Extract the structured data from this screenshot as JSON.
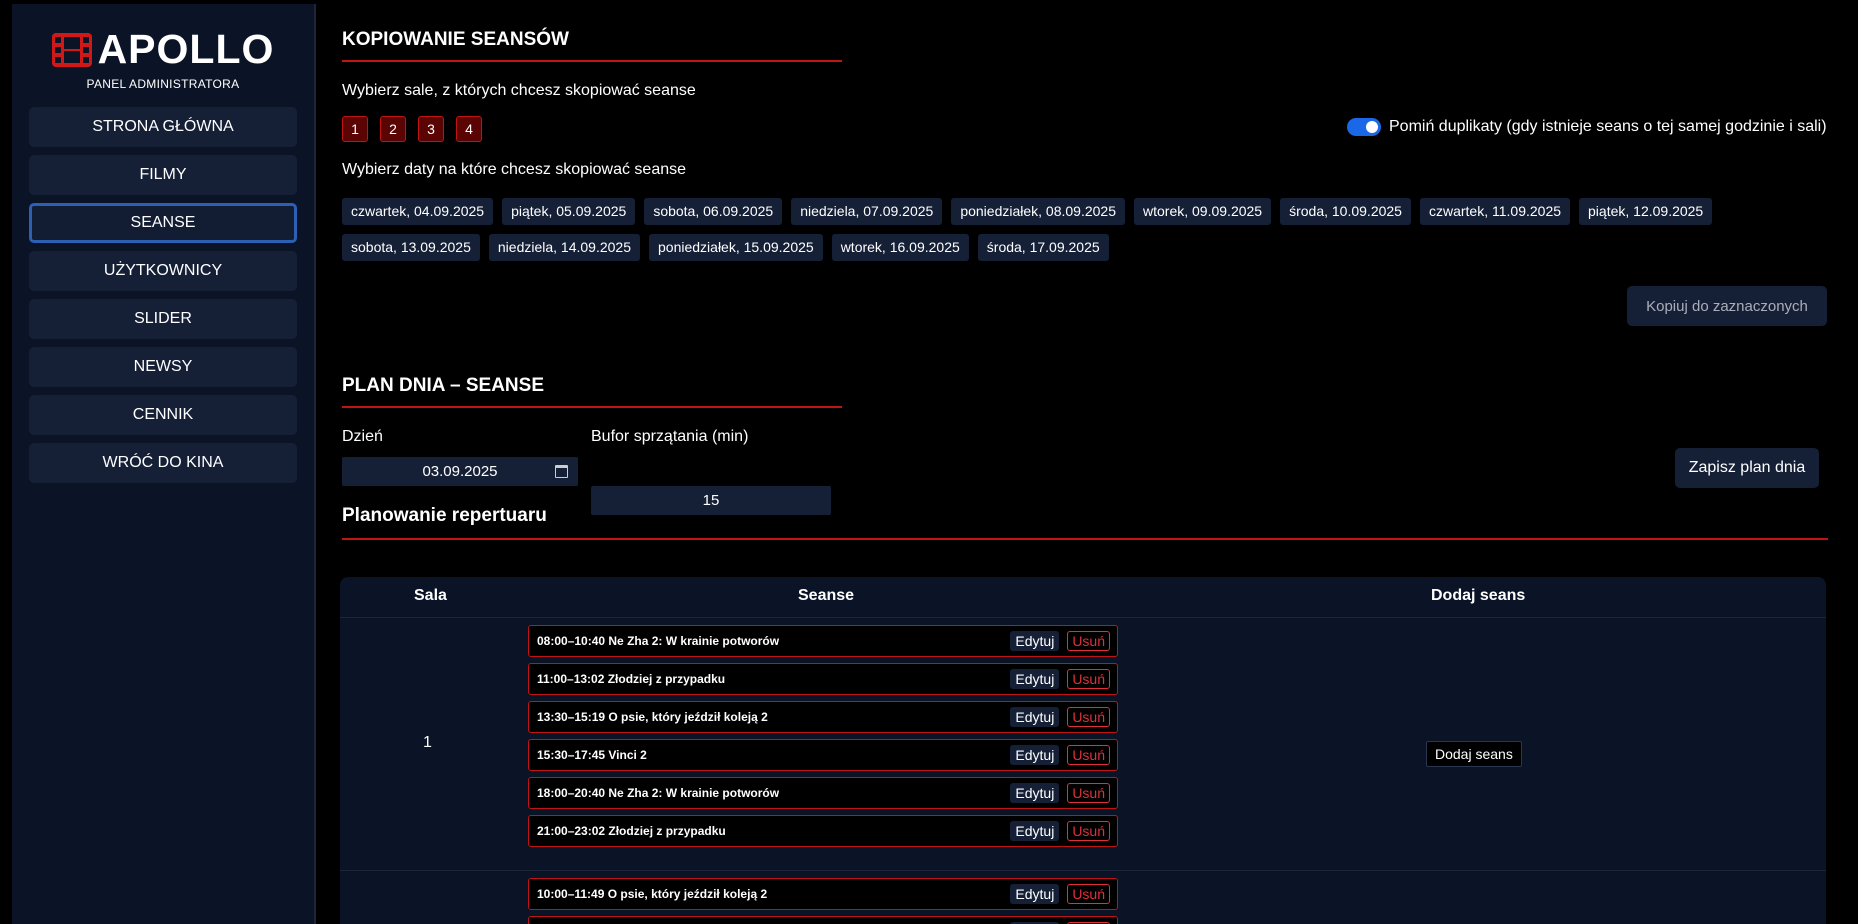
{
  "brand": {
    "name": "APOLLO",
    "subtitle": "PANEL ADMINISTRATORA"
  },
  "nav": [
    {
      "label": "STRONA GŁÓWNA",
      "active": false
    },
    {
      "label": "FILMY",
      "active": false
    },
    {
      "label": "SEANSE",
      "active": true
    },
    {
      "label": "UŻYTKOWNICY",
      "active": false
    },
    {
      "label": "SLIDER",
      "active": false
    },
    {
      "label": "NEWSY",
      "active": false
    },
    {
      "label": "CENNIK",
      "active": false
    },
    {
      "label": "WRÓĆ DO KINA",
      "active": false
    }
  ],
  "copy": {
    "title": "KOPIOWANIE SEANSÓW",
    "halls_label": "Wybierz sale, z których chcesz skopiować seanse",
    "halls": [
      "1",
      "2",
      "3",
      "4"
    ],
    "skip_duplicates_label": "Pomiń duplikaty (gdy istnieje seans o tej samej godzinie i sali)",
    "skip_duplicates": true,
    "dates_label": "Wybierz daty na które chcesz skopiować seanse",
    "dates_row1": [
      "czwartek, 04.09.2025",
      "piątek, 05.09.2025",
      "sobota, 06.09.2025",
      "niedziela, 07.09.2025",
      "poniedziałek, 08.09.2025",
      "wtorek, 09.09.2025",
      "środa, 10.09.2025",
      "czwartek, 11.09.2025",
      "piątek, 12.09.2025"
    ],
    "dates_row2": [
      "sobota, 13.09.2025",
      "niedziela, 14.09.2025",
      "poniedziałek, 15.09.2025",
      "wtorek, 16.09.2025",
      "środa, 17.09.2025"
    ],
    "copy_button": "Kopiuj do zaznaczonych"
  },
  "plan": {
    "title": "PLAN DNIA – SEANSE",
    "day_label": "Dzień",
    "day_value": "03.09.2025",
    "buffer_label": "Bufor sprzątania (min)",
    "buffer_value": "15",
    "save_button": "Zapisz plan dnia"
  },
  "repertoire": {
    "title": "Planowanie repertuaru",
    "columns": [
      "Sala",
      "Seanse",
      "Dodaj seans"
    ],
    "edit_label": "Edytuj",
    "delete_label": "Usuń",
    "add_label": "Dodaj seans",
    "rows": [
      {
        "hall": "1",
        "shows": [
          "08:00–10:40 Ne Zha 2: W krainie potworów",
          "11:00–13:02 Złodziej z przypadku",
          "13:30–15:19 O psie, który jeździł koleją 2",
          "15:30–17:45 Vinci 2",
          "18:00–20:40 Ne Zha 2: W krainie potworów",
          "21:00–23:02 Złodziej z przypadku"
        ]
      },
      {
        "hall": "",
        "shows": [
          "10:00–11:49 O psie, który jeździł koleją 2",
          ""
        ]
      }
    ]
  },
  "colors": {
    "accent_red": "#c01414",
    "toggle_blue": "#1a68e8",
    "panel": "#0b1426",
    "chip": "#152037"
  }
}
